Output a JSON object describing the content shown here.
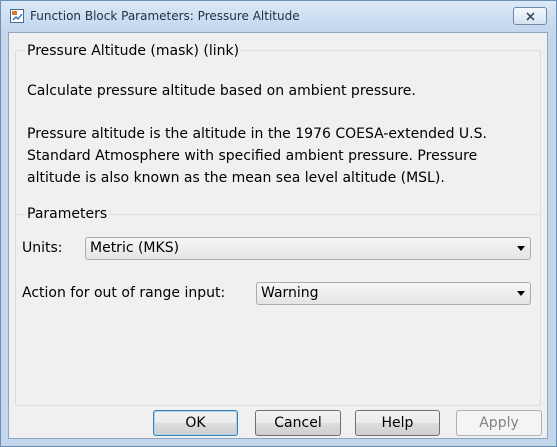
{
  "window": {
    "title": "Function Block Parameters: Pressure Altitude"
  },
  "description": {
    "group_title": "Pressure Altitude (mask) (link)",
    "summary": "Calculate pressure altitude based on ambient pressure.",
    "body_lines": [
      "Pressure altitude is the altitude in the 1976 COESA-extended U.S.",
      "Standard Atmosphere with specified ambient pressure.  Pressure",
      "altitude is also known as the mean sea level altitude (MSL)."
    ]
  },
  "parameters": {
    "group_title": "Parameters",
    "units_label": "Units:",
    "units_value": "Metric (MKS)",
    "action_label": "Action for out of range input:",
    "action_value": "Warning"
  },
  "buttons": {
    "ok": "OK",
    "cancel": "Cancel",
    "help": "Help",
    "apply": "Apply"
  },
  "icons": {
    "app_icon": "simulink-block-icon",
    "close_icon": "close-icon"
  }
}
